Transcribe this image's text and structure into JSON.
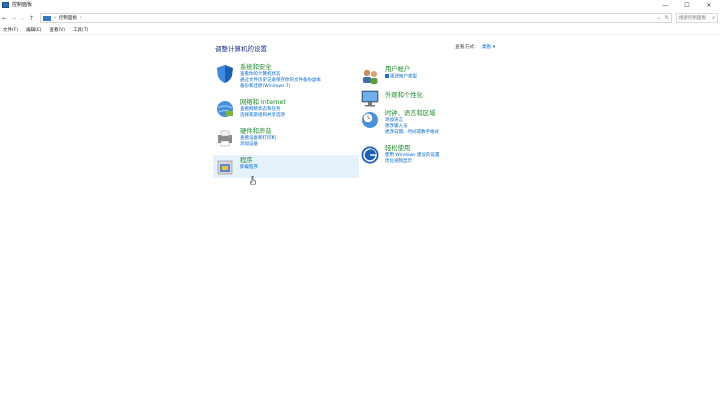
{
  "window": {
    "title": "控制面板",
    "minimize": "—",
    "maximize": "☐",
    "close": "✕"
  },
  "nav": {
    "back": "←",
    "forward": "→",
    "down": "⌄",
    "up": "↑",
    "path": "控制面板",
    "separator": "›",
    "dropdown": "⌄",
    "refresh": "↻",
    "search_placeholder": "搜索控制面板",
    "search_icon": "⌕"
  },
  "menu": [
    "文件(F)",
    "编辑(E)",
    "查看(V)",
    "工具(T)"
  ],
  "main": {
    "title": "调整计算机的设置",
    "view_by_label": "查看方式:",
    "view_by_value": "类别 ▾"
  },
  "categories": [
    {
      "title": "系统和安全",
      "links": [
        "查看你的计算机状态",
        "通过文件历史记录保存你的文件备份副本",
        "备份和还原(Windows 7)"
      ]
    },
    {
      "title": "网络和 Internet",
      "links": [
        "查看网络状态和任务",
        "选择家庭组和共享选项"
      ]
    },
    {
      "title": "硬件和声音",
      "links": [
        "查看设备和打印机",
        "添加设备"
      ]
    },
    {
      "title": "程序",
      "links": [
        "卸载程序"
      ]
    },
    {
      "title": "用户帐户",
      "links": [
        "更改帐户类型"
      ]
    },
    {
      "title": "外观和个性化",
      "links": []
    },
    {
      "title": "时钟、语言和区域",
      "links": [
        "添加语言",
        "更改输入法",
        "更改日期、时间或数字格式"
      ]
    },
    {
      "title": "轻松使用",
      "links": [
        "使用 Windows 建议的设置",
        "优化视频显示"
      ]
    }
  ],
  "colors": {
    "category_title": "#1a8a2a",
    "link": "#0066cc",
    "page_title": "#1e3287",
    "hover_bg": "#e5f1fb"
  }
}
